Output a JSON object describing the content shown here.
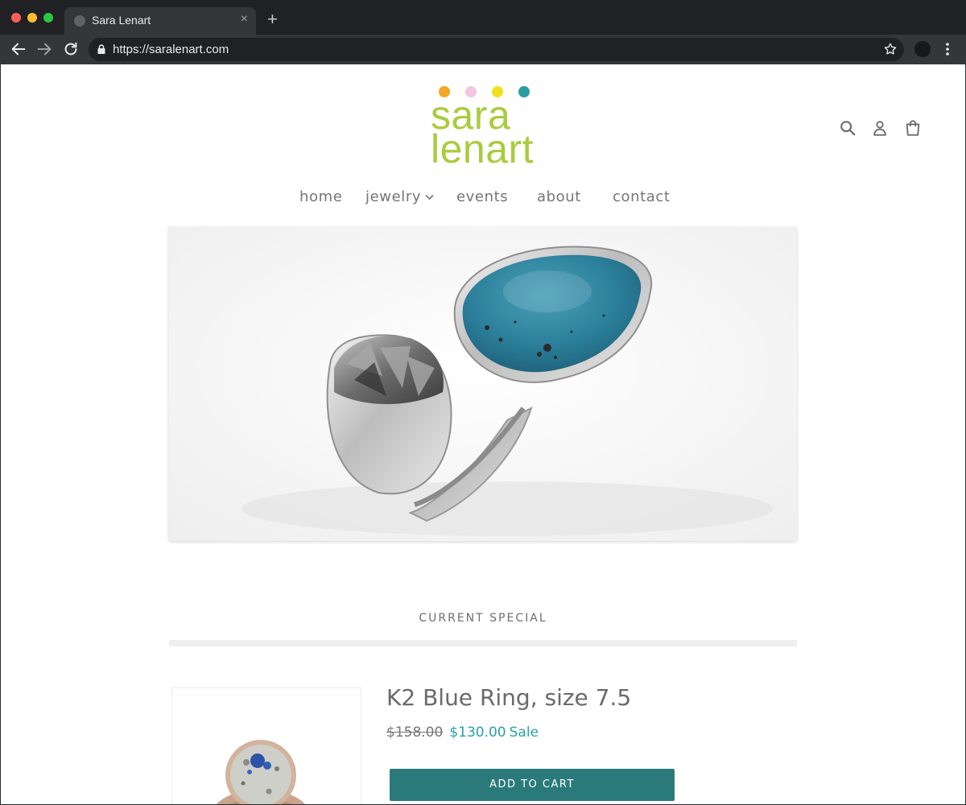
{
  "browser": {
    "tab_title": "Sara Lenart",
    "tab_close": "×",
    "new_tab": "+",
    "url": "https://saralenart.com"
  },
  "logo": {
    "line1": "sara",
    "line2": "lenart",
    "text_color": "#a9cc3d",
    "dot_colors": [
      "#f5a623",
      "#f2c6de",
      "#f1e01f",
      "#2a9d9f"
    ]
  },
  "header_icons": [
    "search-icon",
    "account-icon",
    "cart-icon"
  ],
  "nav": {
    "items": [
      {
        "label": "home"
      },
      {
        "label": "jewelry",
        "has_dropdown": true
      },
      {
        "label": "events"
      },
      {
        "label": "about"
      },
      {
        "label": "contact"
      }
    ]
  },
  "special": {
    "section_title": "CURRENT SPECIAL",
    "product_title": "K2 Blue Ring, size 7.5",
    "price_original": "$158.00",
    "price_sale": "$130.00",
    "sale_label": "Sale",
    "add_to_cart": "ADD TO CART"
  },
  "colors": {
    "accent": "#2aa1a5",
    "button": "#2b7a7b",
    "nav_text": "#757575"
  }
}
